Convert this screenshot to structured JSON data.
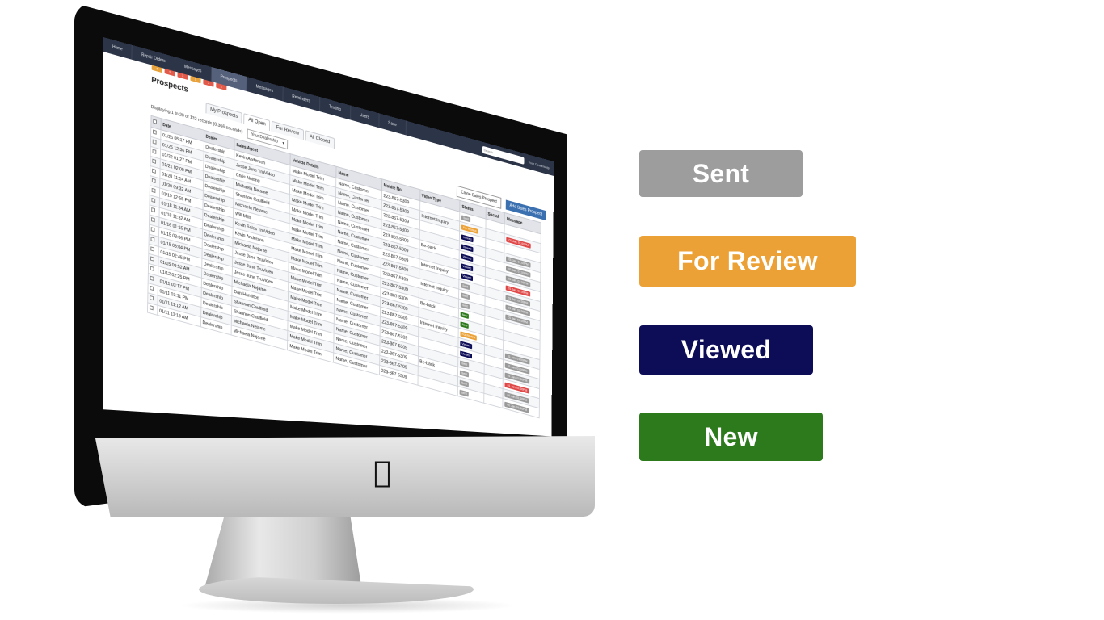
{
  "app": {
    "nav_tabs": [
      "Home",
      "Repair Orders",
      "Messages",
      "Prospects",
      "Messages",
      "Reminders",
      "Texting",
      "Users",
      "Save"
    ],
    "nav_badges": [
      {
        "label": "4",
        "color": "orange"
      },
      {
        "label": "2",
        "color": "red"
      },
      {
        "label": "3",
        "color": "red"
      },
      {
        "label": "2",
        "color": "orange"
      },
      {
        "label": "7",
        "color": "red"
      },
      {
        "label": "1",
        "color": "red"
      }
    ],
    "search_placeholder": "Search",
    "user_label": "Your Dealership",
    "page_title": "Prospects",
    "subtabs": [
      "My Prospects",
      "All Open",
      "For Review",
      "All Closed"
    ],
    "records_label": "Displaying 1 to 20 of 132 records (0.366 seconds)",
    "dealership_select": "Your Dealership",
    "clone_button": "Clone Sales Prospect",
    "add_button": "Add Sales Prospect",
    "columns": [
      "",
      "Date",
      "Dealer",
      "Sales Agent",
      "Vehicle Details",
      "Name",
      "Mobile No.",
      "Video Type",
      "Status",
      "Social",
      "Message"
    ],
    "rows": [
      {
        "date": "01/26 05:17 PM",
        "dealer": "Dealership",
        "agent": "Kevin Anderson",
        "vehicle": "Make Model Trim",
        "name": "Name, Customer",
        "mobile": "223-867-5309",
        "video": "",
        "status": "Sent",
        "message": ""
      },
      {
        "date": "01/25 12:36 PM",
        "dealer": "Dealership",
        "agent": "Jesse June TruVideo",
        "vehicle": "Make Model Trim",
        "name": "Name, Customer",
        "mobile": "223-867-5309",
        "video": "Internet Inquiry",
        "status": "For Review",
        "message": "01 Jan, 01:00PM"
      },
      {
        "date": "01/22 01:27 PM",
        "dealer": "Dealership",
        "agent": "Chris Nutting",
        "vehicle": "Make Model Trim",
        "name": "Name, Customer",
        "mobile": "223-867-5309",
        "video": "",
        "status": "Viewed",
        "message": ""
      },
      {
        "date": "01/21 02:09 PM",
        "dealer": "Dealership",
        "agent": "Michaela Nejame",
        "vehicle": "Make Model Trim",
        "name": "Name, Customer",
        "mobile": "223-867-5309",
        "video": "",
        "status": "Viewed",
        "message": "01 Jan, 01:00PM"
      },
      {
        "date": "01/20 11:14 AM",
        "dealer": "Dealership",
        "agent": "Shannon Caulfield",
        "vehicle": "Make Model Trim",
        "name": "Name, Customer",
        "mobile": "223-867-5309",
        "video": "Be-back",
        "status": "Viewed",
        "message": "01 Jan, 01:00PM"
      },
      {
        "date": "01/20 09:32 AM",
        "dealer": "Dealership",
        "agent": "Michaela Nejame",
        "vehicle": "Make Model Trim",
        "name": "Name, Customer",
        "mobile": "223-867-5309",
        "video": "",
        "status": "Viewed",
        "message": "01 Jan, 01:00PM"
      },
      {
        "date": "01/19 12:55 PM",
        "dealer": "Dealership",
        "agent": "Will Mills",
        "vehicle": "Make Model Trim",
        "name": "Name, Customer",
        "mobile": "223-867-5309",
        "video": "Internet Inquiry",
        "status": "Viewed",
        "message": "01 Jan, 01:00PM"
      },
      {
        "date": "01/18 11:34 AM",
        "dealer": "Dealership",
        "agent": "Kevin Sales TruVideo",
        "vehicle": "Make Model Trim",
        "name": "Name, Customer",
        "mobile": "223-867-5309",
        "video": "",
        "status": "Sent",
        "message": "01 Jan, 01:00PM"
      },
      {
        "date": "01/18 11:32 AM",
        "dealer": "Dealership",
        "agent": "Kevin Anderson",
        "vehicle": "Make Model Trim",
        "name": "Name, Customer",
        "mobile": "223-867-5309",
        "video": "Internet Inquiry",
        "status": "Sent",
        "message": "01 Jan, 01:00PM"
      },
      {
        "date": "01/16 01:15 PM",
        "dealer": "Dealership",
        "agent": "Michaela Nejame",
        "vehicle": "Make Model Trim",
        "name": "Name, Customer",
        "mobile": "223-867-5309",
        "video": "",
        "status": "Sent",
        "message": "01 Jan, 01:00PM"
      },
      {
        "date": "01/15 03:06 PM",
        "dealer": "Dealership",
        "agent": "Jesse June TruVideo",
        "vehicle": "Make Model Trim",
        "name": "Name, Customer",
        "mobile": "223-867-5309",
        "video": "Be-back",
        "status": "New",
        "message": ""
      },
      {
        "date": "01/15 03:04 PM",
        "dealer": "Dealership",
        "agent": "Jesse June TruVideo",
        "vehicle": "Make Model Trim",
        "name": "Name, Customer",
        "mobile": "223-867-5309",
        "video": "",
        "status": "New",
        "message": ""
      },
      {
        "date": "01/15 02:45 PM",
        "dealer": "Dealership",
        "agent": "Jesse June TruVideo",
        "vehicle": "Make Model Trim",
        "name": "Name, Customer",
        "mobile": "223-867-5309",
        "video": "Internet Inquiry",
        "status": "For Review",
        "message": ""
      },
      {
        "date": "01/15 09:52 AM",
        "dealer": "Dealership",
        "agent": "Michaela Nejame",
        "vehicle": "Make Model Trim",
        "name": "Name, Customer",
        "mobile": "223-867-5309",
        "video": "",
        "status": "Viewed",
        "message": "01 Jan, 01:00PM"
      },
      {
        "date": "01/12 02:25 PM",
        "dealer": "Dealership",
        "agent": "Dan Hamilton",
        "vehicle": "Make Model Trim",
        "name": "Name, Customer",
        "mobile": "223-867-5309",
        "video": "",
        "status": "Viewed",
        "message": "01 Jan, 01:00PM"
      },
      {
        "date": "01/11 03:17 PM",
        "dealer": "Dealership",
        "agent": "Shannon Caulfield",
        "vehicle": "Make Model Trim",
        "name": "Name, Customer",
        "mobile": "223-867-5309",
        "video": "",
        "status": "Sent",
        "message": "01 Jan, 01:00PM"
      },
      {
        "date": "01/11 03:11 PM",
        "dealer": "Dealership",
        "agent": "Shannon Caulfield",
        "vehicle": "Make Model Trim",
        "name": "Name, Customer",
        "mobile": "223-867-5309",
        "video": "Be-back",
        "status": "Sent",
        "message": "01 Jan, 01:00PM"
      },
      {
        "date": "01/11 11:12 AM",
        "dealer": "Dealership",
        "agent": "Michaela Nejame",
        "vehicle": "Make Model Trim",
        "name": "Name, Customer",
        "mobile": "223-867-5309",
        "video": "",
        "status": "Sent",
        "message": "01 Jan, 01:00PM"
      },
      {
        "date": "01/11 11:13 AM",
        "dealer": "Dealership",
        "agent": "Michaela Nejame",
        "vehicle": "Make Model Trim",
        "name": "Name, Customer",
        "mobile": "223-867-5309",
        "video": "",
        "status": "Sent",
        "message": "01 Jan, 01:00PM"
      }
    ]
  },
  "legend": {
    "sent": "Sent",
    "for_review": "For Review",
    "viewed": "Viewed",
    "new": "New"
  },
  "colors": {
    "sent": "#9d9d9d",
    "for_review": "#eba135",
    "viewed": "#0c0c57",
    "new": "#2c7a1b",
    "nav": "#2c3547"
  },
  "icons": {
    "apple_logo": "apple-logo-icon"
  }
}
